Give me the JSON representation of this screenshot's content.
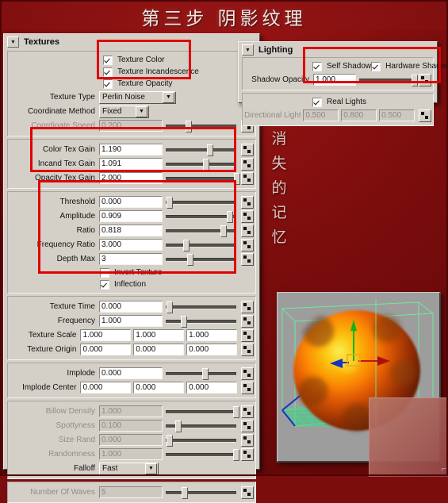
{
  "poster": {
    "title": "第三步 阴影纹理",
    "vertical_caption": [
      "消",
      "失",
      "的",
      "记",
      "忆"
    ],
    "background_color": "#7c0d0d",
    "panel_color": "#d4d0c8",
    "annotation_color": "#e00000"
  },
  "textures_panel": {
    "header": "Textures",
    "collapse_icon": "triangle-down-icon",
    "checkboxes": [
      {
        "label": "Texture Color",
        "checked": true
      },
      {
        "label": "Texture Incandescence",
        "checked": true
      },
      {
        "label": "Texture Opacity",
        "checked": true
      }
    ],
    "texture_type": {
      "label": "Texture Type",
      "value": "Perlin Noise"
    },
    "coordinate_method": {
      "label": "Coordinate Method",
      "value": "Fixed"
    },
    "coordinate_speed": {
      "label": "Coordinate Speed",
      "value": "0.200",
      "disabled": true,
      "slider_pct": 28
    },
    "gain_rows": [
      {
        "label": "Color Tex Gain",
        "value": "1.190",
        "slider_pct": 58
      },
      {
        "label": "Incand Tex Gain",
        "value": "1.091",
        "slider_pct": 53
      },
      {
        "label": "Opacity Tex Gain",
        "value": "2.000",
        "slider_pct": 97
      }
    ],
    "noise_rows": [
      {
        "label": "Threshold",
        "value": "0.000",
        "slider_pct": 2
      },
      {
        "label": "Amplitude",
        "value": "0.909",
        "slider_pct": 86
      },
      {
        "label": "Ratio",
        "value": "0.818",
        "slider_pct": 78
      },
      {
        "label": "Frequency Ratio",
        "value": "3.000",
        "slider_pct": 25
      },
      {
        "label": "Depth Max",
        "value": "3",
        "slider_pct": 30
      }
    ],
    "noise_checkboxes": [
      {
        "label": "Invert Texture",
        "checked": false
      },
      {
        "label": "Inflection",
        "checked": true
      }
    ],
    "time_rows": [
      {
        "label": "Texture Time",
        "value": "0.000",
        "slider_pct": 2
      },
      {
        "label": "Frequency",
        "value": "1.000",
        "slider_pct": 21
      }
    ],
    "vector_rows": [
      {
        "label": "Texture Scale",
        "values": [
          "1.000",
          "1.000",
          "1.000"
        ]
      },
      {
        "label": "Texture Origin",
        "values": [
          "0.000",
          "0.000",
          "0.000"
        ]
      }
    ],
    "implode": {
      "label": "Implode",
      "value": "0.000",
      "slider_pct": 52
    },
    "implode_center": {
      "label": "Implode Center",
      "values": [
        "0.000",
        "0.000",
        "0.000"
      ]
    },
    "billow_rows": [
      {
        "label": "Billow Density",
        "value": "1.000",
        "slider_pct": 95,
        "disabled": true
      },
      {
        "label": "Spottyness",
        "value": "0.100",
        "slider_pct": 13,
        "disabled": true
      },
      {
        "label": "Size Rand",
        "value": "0.000",
        "slider_pct": 2,
        "disabled": true
      },
      {
        "label": "Randomness",
        "value": "1.000",
        "slider_pct": 95,
        "disabled": true
      }
    ],
    "falloff": {
      "label": "Falloff",
      "value": "Fast"
    },
    "number_of_waves": {
      "label": "Number Of Waves",
      "value": "5",
      "slider_pct": 23,
      "disabled": true
    }
  },
  "lighting_panel": {
    "header": "Lighting",
    "collapse_icon": "triangle-down-icon",
    "self_shadow": {
      "label": "Self Shadow",
      "checked": true
    },
    "hardware_shadow": {
      "label": "Hardware Shadow",
      "checked": true
    },
    "shadow_opacity": {
      "label": "Shadow Opacity",
      "value": "1.000",
      "slider_pct": 95
    },
    "real_lights": {
      "label": "Real Lights",
      "checked": true
    },
    "directional_light": {
      "label": "Directional Light",
      "values": [
        "0.500",
        "0.800",
        "0.500"
      ],
      "disabled": true
    }
  },
  "viewport": {
    "name": "maya-perspective-viewport",
    "content": "fluid explosion fireball inside green wireframe container with move manipulator and ground grid",
    "container_wire_color": "#6bf09a",
    "grid_color": "#49e08a",
    "axis_x_color": "#c81414",
    "axis_y_color": "#14b414",
    "axis_z_color": "#1432c8",
    "manipulator_color": "#e8a81e"
  },
  "overlay_pane": {
    "name": "translucent-overlay-window",
    "glyph": "⌐"
  }
}
